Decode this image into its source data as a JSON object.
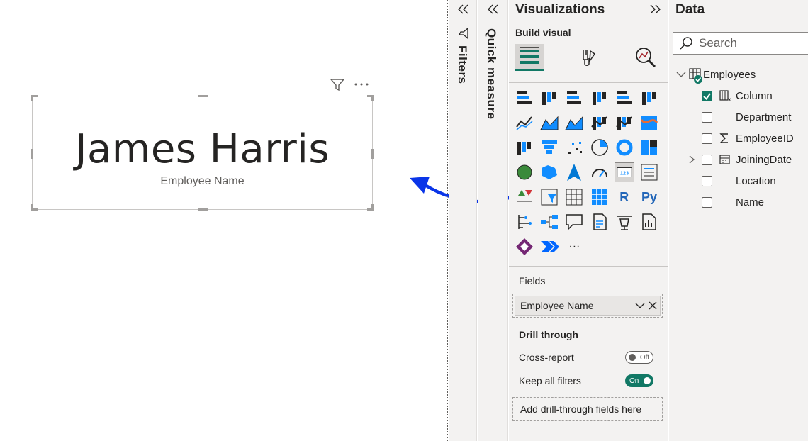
{
  "card": {
    "value": "James Harris",
    "label": "Employee Name"
  },
  "filters_pane": {
    "title": "Filters"
  },
  "quick_measure_pane": {
    "title": "Quick measure"
  },
  "visualizations": {
    "title": "Visualizations",
    "build_visual": "Build visual",
    "fields_label": "Fields",
    "field_value": "Employee Name",
    "drill_through": {
      "title": "Drill through",
      "cross_report": {
        "label": "Cross-report",
        "state": "Off"
      },
      "keep_all_filters": {
        "label": "Keep all filters",
        "state": "On"
      },
      "add_placeholder": "Add drill-through fields here"
    },
    "text_icons": {
      "r": "R",
      "py": "Py",
      "more": "···"
    }
  },
  "data_pane": {
    "title": "Data",
    "search_placeholder": "Search",
    "table": {
      "name": "Employees",
      "fields": [
        {
          "name": "Column",
          "checked": true
        },
        {
          "name": "Department",
          "checked": false
        },
        {
          "name": "EmployeeID",
          "checked": false
        },
        {
          "name": "JoiningDate",
          "checked": false
        },
        {
          "name": "Location",
          "checked": false
        },
        {
          "name": "Name",
          "checked": false
        }
      ]
    }
  },
  "colors": {
    "accent": "#117865",
    "arrow": "#0a35e8",
    "pane_bg": "#f3f2f1",
    "viz_blue": "#118dff"
  }
}
